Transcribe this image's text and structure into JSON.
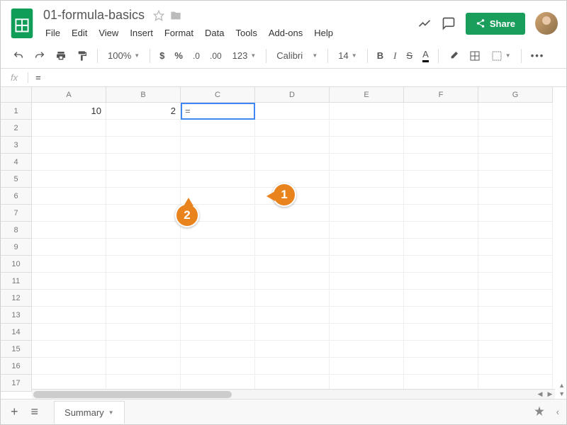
{
  "header": {
    "title": "01-formula-basics",
    "menus": [
      "File",
      "Edit",
      "View",
      "Insert",
      "Format",
      "Data",
      "Tools",
      "Add-ons",
      "Help"
    ],
    "share_label": "Share"
  },
  "toolbar": {
    "zoom": "100%",
    "font": "Calibri",
    "font_size": "14",
    "number_format": "123"
  },
  "formula_bar": {
    "fx": "fx",
    "value": "="
  },
  "grid": {
    "columns": [
      "A",
      "B",
      "C",
      "D",
      "E",
      "F",
      "G"
    ],
    "rows": [
      "1",
      "2",
      "3",
      "4",
      "5",
      "6",
      "7",
      "8",
      "9",
      "10",
      "11",
      "12",
      "13",
      "14",
      "15",
      "16",
      "17"
    ],
    "cells": {
      "A1": "10",
      "B1": "2",
      "C1": "="
    },
    "active": "C1"
  },
  "callouts": {
    "1": "1",
    "2": "2"
  },
  "tabs": {
    "sheet_name": "Summary"
  }
}
